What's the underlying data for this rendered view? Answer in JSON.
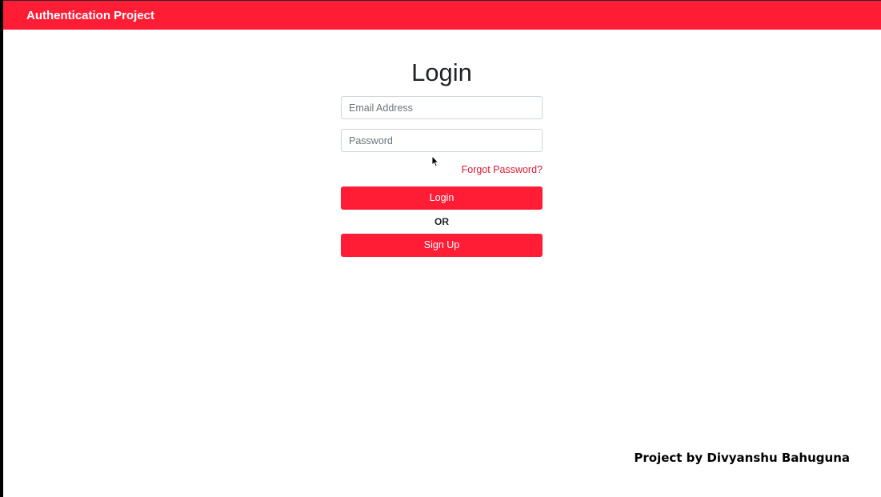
{
  "navbar": {
    "brand": "Authentication Project",
    "color": "#ff1d36"
  },
  "login_form": {
    "title": "Login",
    "email": {
      "placeholder": "Email Address",
      "value": ""
    },
    "password": {
      "placeholder": "Password",
      "value": ""
    },
    "forgot_password_link": "Forgot Password?",
    "login_button": "Login",
    "separator": "OR",
    "signup_button": "Sign Up"
  },
  "footer": {
    "credit": "Project by Divyanshu Bahuguna"
  },
  "colors": {
    "accent": "#ff1d36",
    "link": "#dc1a35"
  },
  "icons": {
    "cursor": "mouse-pointer-icon"
  }
}
